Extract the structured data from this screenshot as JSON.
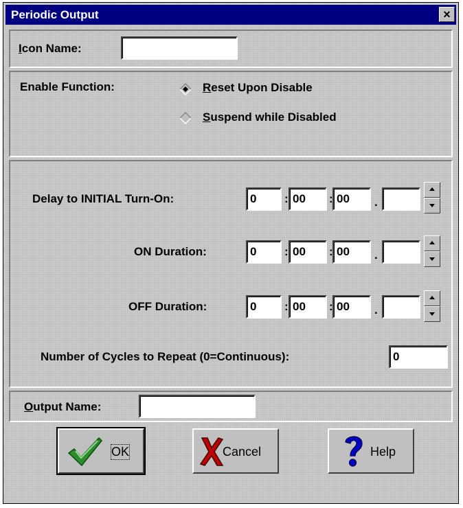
{
  "window": {
    "title": "Periodic Output",
    "close_label": "×"
  },
  "icon_name": {
    "label_u": "I",
    "label_rest": "con Name:",
    "value": ""
  },
  "enable": {
    "label": "Enable Function:",
    "options": [
      {
        "label_u": "R",
        "label_rest": "eset Upon Disable",
        "selected": true
      },
      {
        "label_u": "S",
        "label_rest": "uspend while Disabled",
        "selected": false
      }
    ]
  },
  "timers": [
    {
      "label": "Delay to INITIAL Turn-On:",
      "h": "0",
      "m": "00",
      "s": "00",
      "f": ""
    },
    {
      "label": "ON Duration:",
      "h": "0",
      "m": "00",
      "s": "00",
      "f": ""
    },
    {
      "label": "OFF Duration:",
      "h": "0",
      "m": "00",
      "s": "00",
      "f": ""
    }
  ],
  "separators": {
    "colon": ":",
    "dot": "."
  },
  "cycles": {
    "label": "Number of Cycles to Repeat (0=Continuous):",
    "value": "0"
  },
  "output_name": {
    "label_u": "O",
    "label_rest": "utput Name:",
    "value": ""
  },
  "buttons": {
    "ok": "OK",
    "cancel": "Cancel",
    "help": "Help"
  },
  "icons": {
    "ok": "check-icon",
    "cancel": "x-mark-icon",
    "help": "question-mark-icon"
  },
  "colors": {
    "titlebar": "#000080",
    "face": "#c0c0c0",
    "check": "#2e8b2e",
    "cancel_x": "#c00000",
    "help": "#0000c0"
  }
}
